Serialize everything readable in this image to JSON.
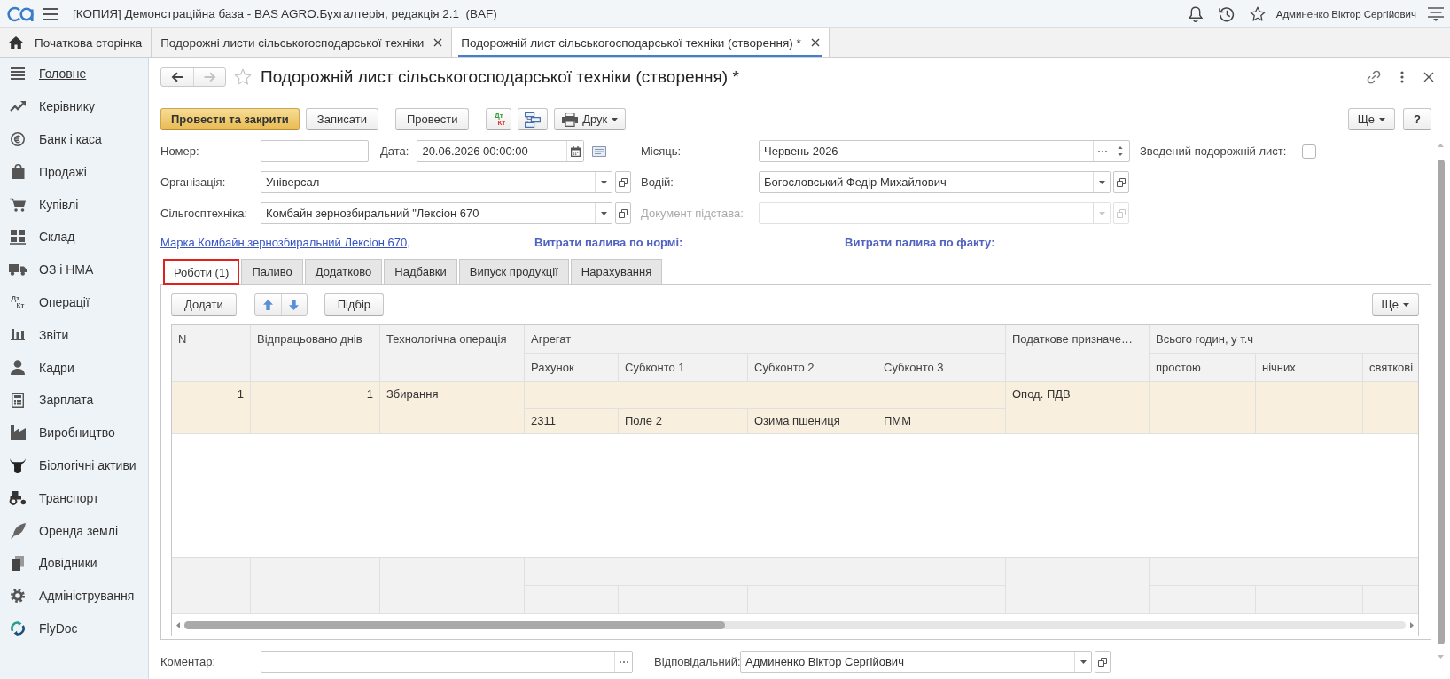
{
  "app_bar": {
    "title": "[КОПИЯ] Демонстраційна база - BAS AGRO.Бухгалтерія, редакція 2.1  (BAF)",
    "user": "Админенко Віктор Сергійович"
  },
  "open_tabs": [
    {
      "kind": "home",
      "label": "Початкова сторінка",
      "selected": false
    },
    {
      "kind": "document",
      "label": "Подорожні листи сільськогосподарської техніки",
      "selected": false
    },
    {
      "kind": "document",
      "label": "Подорожній лист сільськогосподарської техніки (створення) *",
      "selected": true
    }
  ],
  "sidebar": {
    "items": [
      {
        "label": "Головне",
        "selected": true
      },
      {
        "label": "Керівнику",
        "selected": false
      },
      {
        "label": "Банк і каса",
        "selected": false
      },
      {
        "label": "Продажі",
        "selected": false
      },
      {
        "label": "Купівлі",
        "selected": false
      },
      {
        "label": "Склад",
        "selected": false
      },
      {
        "label": "ОЗ і НМА",
        "selected": false
      },
      {
        "label": "Операції",
        "selected": false,
        "debit": "Дт",
        "credit": "Кт"
      },
      {
        "label": "Звіти",
        "selected": false
      },
      {
        "label": "Кадри",
        "selected": false
      },
      {
        "label": "Зарплата",
        "selected": false
      },
      {
        "label": "Виробництво",
        "selected": false
      },
      {
        "label": "Біологічні активи",
        "selected": false
      },
      {
        "label": "Транспорт",
        "selected": false
      },
      {
        "label": "Оренда землі",
        "selected": false
      },
      {
        "label": "Довідники",
        "selected": false
      },
      {
        "label": "Адміністрування",
        "selected": false
      },
      {
        "label": "FlyDoc",
        "selected": false
      }
    ]
  },
  "form": {
    "title": "Подорожній лист сільськогосподарської техніки (створення) *",
    "favorite": false,
    "back_disabled": false,
    "forward_disabled": true,
    "toolbar": [
      [
        {
          "kind": "default",
          "label": "Провести та закрити"
        },
        {
          "kind": "plain",
          "label": "Записати"
        }
      ],
      [
        {
          "kind": "plain",
          "label": "Провести"
        }
      ],
      [
        {
          "kind": "posting",
          "debit": "Дт",
          "credit": "Кт"
        },
        {
          "kind": "structure"
        },
        {
          "kind": "print",
          "label": "Друк"
        }
      ]
    ],
    "toolbar_right": [
      {
        "kind": "menu",
        "label": "Ще"
      },
      {
        "kind": "help",
        "label": "?"
      }
    ],
    "header_rows": [
      {
        "left": [
          {
            "kind": "text",
            "label": "Номер:",
            "disabled": false
          },
          {
            "kind": "date",
            "label": "Дата:",
            "value": "20.06.2026 00:00:00",
            "disabled": false
          }
        ],
        "right": [
          {
            "kind": "period",
            "label": "Місяць:",
            "value": "Червень 2026",
            "disabled": false
          }
        ],
        "extra": [
          {
            "kind": "checkbox",
            "label": "Зведений подорожній лист:",
            "checked": false,
            "disabled": false
          }
        ]
      },
      {
        "left": [
          {
            "kind": "select",
            "label": "Організація:",
            "value": "Універсал",
            "disabled": false
          }
        ],
        "right": [
          {
            "kind": "select",
            "label": "Водій:",
            "value": "Богословський Федір Михайлович",
            "disabled": false
          }
        ]
      },
      {
        "left": [
          {
            "kind": "select",
            "label": "Сільгосптехніка:",
            "value": "Комбайн зернозбиральний \"Лексіон 670",
            "disabled": false
          }
        ],
        "right": [
          {
            "kind": "select",
            "label": "Документ підстава:",
            "disabled": true
          }
        ]
      }
    ],
    "info_line": {
      "link": "Марка Комбайн зернозбиральний Лексіон 670,",
      "norm_label": "Витрати палива по нормі:",
      "fact_label": "Витрати палива по факту:"
    },
    "doc_tabs": [
      {
        "label": "Роботи (1)",
        "selected": true,
        "highlighted": true
      },
      {
        "label": "Паливо",
        "selected": false,
        "highlighted": false
      },
      {
        "label": "Додатково",
        "selected": false,
        "highlighted": false
      },
      {
        "label": "Надбавки",
        "selected": false,
        "highlighted": false
      },
      {
        "label": "Випуск продукції",
        "selected": false,
        "highlighted": false
      },
      {
        "label": "Нарахування",
        "selected": false,
        "highlighted": false
      }
    ],
    "works": {
      "toolbar": {
        "add": "Додати",
        "pick": "Підбір",
        "more": "Ще"
      },
      "table": {
        "columns": [
          {
            "label": "N",
            "kind": "number"
          },
          {
            "label": "Відпрацьовано днів",
            "kind": "number"
          },
          {
            "label": "Технологічна операція",
            "kind": "text"
          },
          {
            "label": "Агрегат",
            "children": [
              {
                "label": "Рахунок"
              },
              {
                "label": "Субконто 1"
              },
              {
                "label": "Субконто 2"
              },
              {
                "label": "Субконто 3"
              }
            ]
          },
          {
            "label": "Податкове призначе…",
            "kind": "text"
          },
          {
            "label": "Всього годин, у т.ч",
            "children": [
              {
                "label": "простою"
              },
              {
                "label": "нічних"
              },
              {
                "label": "святкові"
              }
            ]
          }
        ],
        "rows": [
          {
            "selected": true,
            "cells": [
              "1",
              "1",
              "Збирання",
              [
                "2311",
                "Поле 2",
                "Озима пшениця",
                "ПММ"
              ],
              "Опод. ПДВ"
            ]
          }
        ]
      }
    },
    "bottom_fields": [
      {
        "kind": "choice",
        "label": "Коментар:",
        "disabled": false
      },
      {
        "kind": "select",
        "label": "Відповідальний:",
        "value": "Админенко Віктор Сергійович",
        "disabled": false
      }
    ]
  }
}
